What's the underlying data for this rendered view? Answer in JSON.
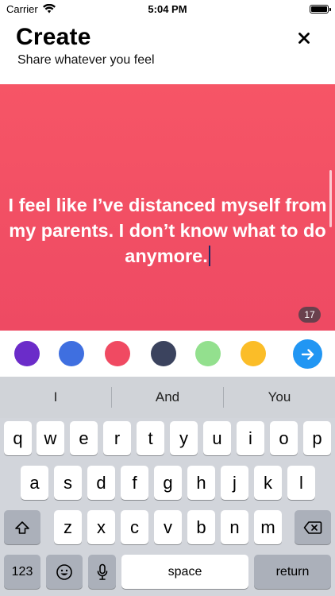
{
  "status": {
    "carrier": "Carrier",
    "time": "5:04 PM"
  },
  "header": {
    "title": "Create",
    "subtitle": "Share whatever you feel",
    "close_icon": "close-icon"
  },
  "post": {
    "text": "I feel like I’ve distanced myself from my parents. I don’t know what to do anymore.",
    "char_count": "17",
    "background": "#f25063"
  },
  "colors": [
    {
      "name": "purple",
      "hex": "#6b2cc9"
    },
    {
      "name": "blue",
      "hex": "#3f6fe0"
    },
    {
      "name": "red",
      "hex": "#f04a62"
    },
    {
      "name": "navy",
      "hex": "#3b435e"
    },
    {
      "name": "green",
      "hex": "#93e08e"
    },
    {
      "name": "yellow",
      "hex": "#fbbd28"
    }
  ],
  "send": {
    "icon": "arrow-right-icon",
    "color": "#2196f3"
  },
  "keyboard": {
    "suggestions": [
      "I",
      "And",
      "You"
    ],
    "row1": [
      "q",
      "w",
      "e",
      "r",
      "t",
      "y",
      "u",
      "i",
      "o",
      "p"
    ],
    "row2": [
      "a",
      "s",
      "d",
      "f",
      "g",
      "h",
      "j",
      "k",
      "l"
    ],
    "row3": [
      "z",
      "x",
      "c",
      "v",
      "b",
      "n",
      "m"
    ],
    "numbers_label": "123",
    "space_label": "space",
    "return_label": "return"
  }
}
